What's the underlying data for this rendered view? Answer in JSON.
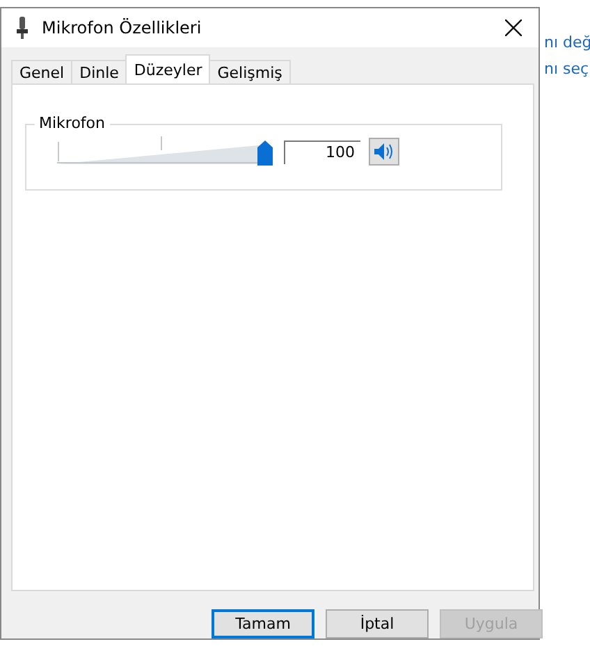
{
  "background_window": {
    "lines": [
      "nı değ",
      "nı seç"
    ]
  },
  "window": {
    "title": "Mikrofon Özellikleri"
  },
  "tabs": [
    {
      "label": "Genel",
      "selected": false
    },
    {
      "label": "Dinle",
      "selected": false
    },
    {
      "label": "Düzeyler",
      "selected": true
    },
    {
      "label": "Gelişmiş",
      "selected": false
    }
  ],
  "levels": [
    {
      "name": "Mikrofon",
      "level": 1.0,
      "reading": "100",
      "muted": false
    }
  ],
  "buttons": [
    {
      "label": "Tamam",
      "default": true,
      "disabled": false
    },
    {
      "label": "İptal",
      "default": false,
      "disabled": false
    },
    {
      "label": "Uygula",
      "default": false,
      "disabled": true
    }
  ]
}
